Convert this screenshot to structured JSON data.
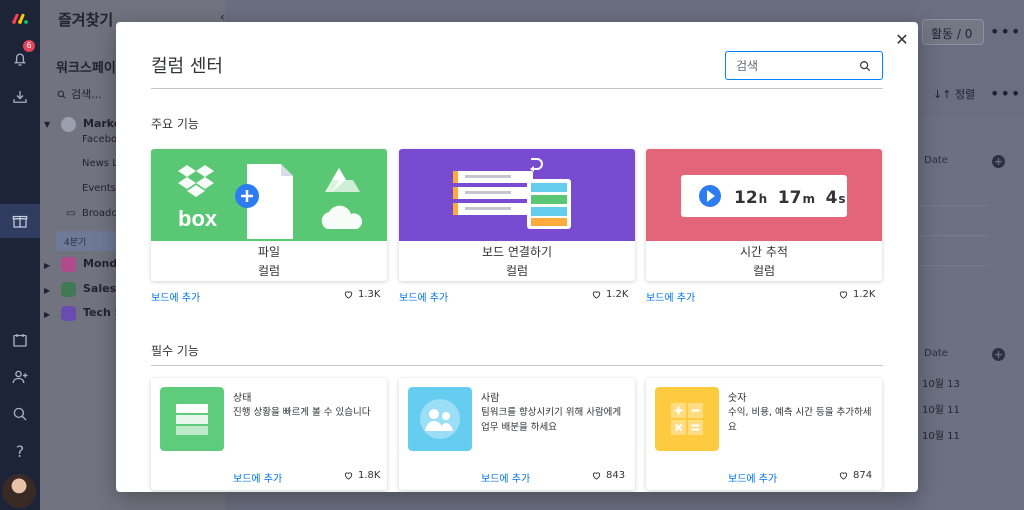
{
  "rail": {
    "notification_count": "6"
  },
  "sidebar": {
    "favorites_title": "즐겨찾기",
    "workspace_title": "워크스페이",
    "search_placeholder": "검색...",
    "items": [
      {
        "label": "Marke"
      },
      {
        "label": "Facebo"
      },
      {
        "label": "News L"
      },
      {
        "label": "Events"
      },
      {
        "label": "Broadca"
      },
      {
        "label": "4분기"
      },
      {
        "label": "Monda"
      },
      {
        "label": "Sales"
      },
      {
        "label": "Tech S"
      }
    ]
  },
  "board": {
    "activity_label": "활동 / 0",
    "sort_label": "정렬",
    "date_header": "Date",
    "dates": [
      "10월 13",
      "10월 11",
      "10월 11"
    ]
  },
  "modal": {
    "title": "컬럼 센터",
    "search_placeholder": "검색",
    "featured_section": "주요 기능",
    "essential_section": "필수 기능",
    "add_to_board": "보드에 추가",
    "featured": [
      {
        "name_line1": "파일",
        "name_line2": "컬럼",
        "likes": "1.3K",
        "color": "#5ac774"
      },
      {
        "name_line1": "보드 연결하기",
        "name_line2": "컬럼",
        "likes": "1.2K",
        "color": "#784bd1"
      },
      {
        "name_line1": "시간 추적",
        "name_line2": "컬럼",
        "likes": "1.2K",
        "color": "#e2657a",
        "timer": {
          "h": "12",
          "h_unit": "h",
          "m": "17",
          "m_unit": "m",
          "s": "4",
          "s_unit": "s"
        }
      }
    ],
    "file_card_art": {
      "logo_text": "box"
    },
    "essential": [
      {
        "title": "상태",
        "description": "진행 상황을 빠르게 볼 수 있습니다",
        "likes": "1.8K",
        "color": "#5fcb7c"
      },
      {
        "title": "사람",
        "description": "팀워크를 향상시키기 위해 사람에게 업무 배분을 하세요",
        "likes": "843",
        "color": "#66ccf0"
      },
      {
        "title": "숫자",
        "description": "수익, 비용, 예측 시간 등을 추가하세요",
        "likes": "874",
        "color": "#fdca40"
      }
    ]
  }
}
